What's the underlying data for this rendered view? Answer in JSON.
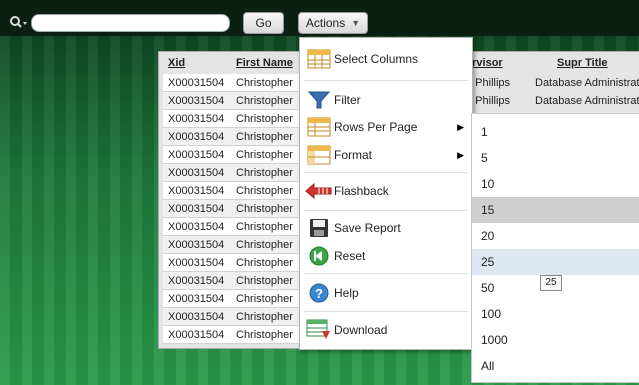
{
  "search": {
    "value": ""
  },
  "toolbar": {
    "go_label": "Go",
    "actions_label": "Actions"
  },
  "report": {
    "columns": [
      "Xid",
      "First Name"
    ],
    "supervisor_header": "ervisor",
    "supr_title_header": "Supr Title",
    "rows": [
      {
        "xid": "X00031504",
        "first": "Christopher",
        "sup": "d Phillips",
        "title": "Database Administrato"
      },
      {
        "xid": "X00031504",
        "first": "Christopher",
        "sup": "d Phillips",
        "title": "Database Administrato"
      },
      {
        "xid": "X00031504",
        "first": "Christopher"
      },
      {
        "xid": "X00031504",
        "first": "Christopher"
      },
      {
        "xid": "X00031504",
        "first": "Christopher"
      },
      {
        "xid": "X00031504",
        "first": "Christopher"
      },
      {
        "xid": "X00031504",
        "first": "Christopher"
      },
      {
        "xid": "X00031504",
        "first": "Christopher"
      },
      {
        "xid": "X00031504",
        "first": "Christopher"
      },
      {
        "xid": "X00031504",
        "first": "Christopher"
      },
      {
        "xid": "X00031504",
        "first": "Christopher"
      },
      {
        "xid": "X00031504",
        "first": "Christopher"
      },
      {
        "xid": "X00031504",
        "first": "Christopher"
      },
      {
        "xid": "X00031504",
        "first": "Christopher"
      },
      {
        "xid": "X00031504",
        "first": "Christopher"
      }
    ]
  },
  "actions_menu": {
    "items": [
      {
        "label": "Select Columns",
        "icon": "select-columns-icon"
      },
      {
        "label": "Filter",
        "icon": "filter-icon"
      },
      {
        "label": "Rows Per Page",
        "icon": "rows-per-page-icon",
        "submenu": true
      },
      {
        "label": "Format",
        "icon": "format-icon",
        "submenu": true
      },
      {
        "label": "Flashback",
        "icon": "flashback-icon"
      },
      {
        "label": "Save Report",
        "icon": "save-icon"
      },
      {
        "label": "Reset",
        "icon": "reset-icon"
      },
      {
        "label": "Help",
        "icon": "help-icon"
      },
      {
        "label": "Download",
        "icon": "download-icon"
      }
    ]
  },
  "rows_per_page_menu": {
    "options": [
      "1",
      "5",
      "10",
      "15",
      "20",
      "25",
      "50",
      "100",
      "1000",
      "All"
    ],
    "hovered": "15",
    "selected": "25"
  },
  "tooltip": {
    "text": "25"
  },
  "colors": {
    "menu_hover": "#cfcfcf",
    "menu_selected": "#dde6f1",
    "background_green": "#2a9a4a"
  }
}
